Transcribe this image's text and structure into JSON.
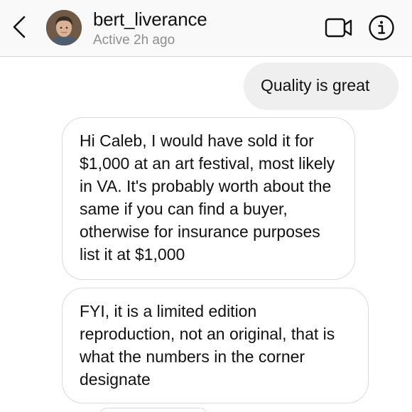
{
  "header": {
    "back_icon": "chevron-left-icon",
    "user_name": "bert_liverance",
    "status": "Active 2h ago",
    "video_icon": "video-camera-icon",
    "info_icon": "info-icon"
  },
  "messages": [
    {
      "direction": "outgoing",
      "text": "Quality is great"
    },
    {
      "direction": "incoming",
      "text": "Hi Caleb, I would have sold it for $1,000 at an art festival, most likely in VA. It's probably worth about the same if you can find a buyer, otherwise for insurance purposes list it at $1,000"
    },
    {
      "direction": "incoming",
      "text": "FYI, it is a limited edition reproduction, not an original, that is what the numbers in the corner designate"
    }
  ],
  "colors": {
    "header_bg": "#f9f9f9",
    "outgoing_bubble": "#efefef",
    "incoming_border": "#dbdbdb",
    "status_text": "#8e8e8e"
  }
}
